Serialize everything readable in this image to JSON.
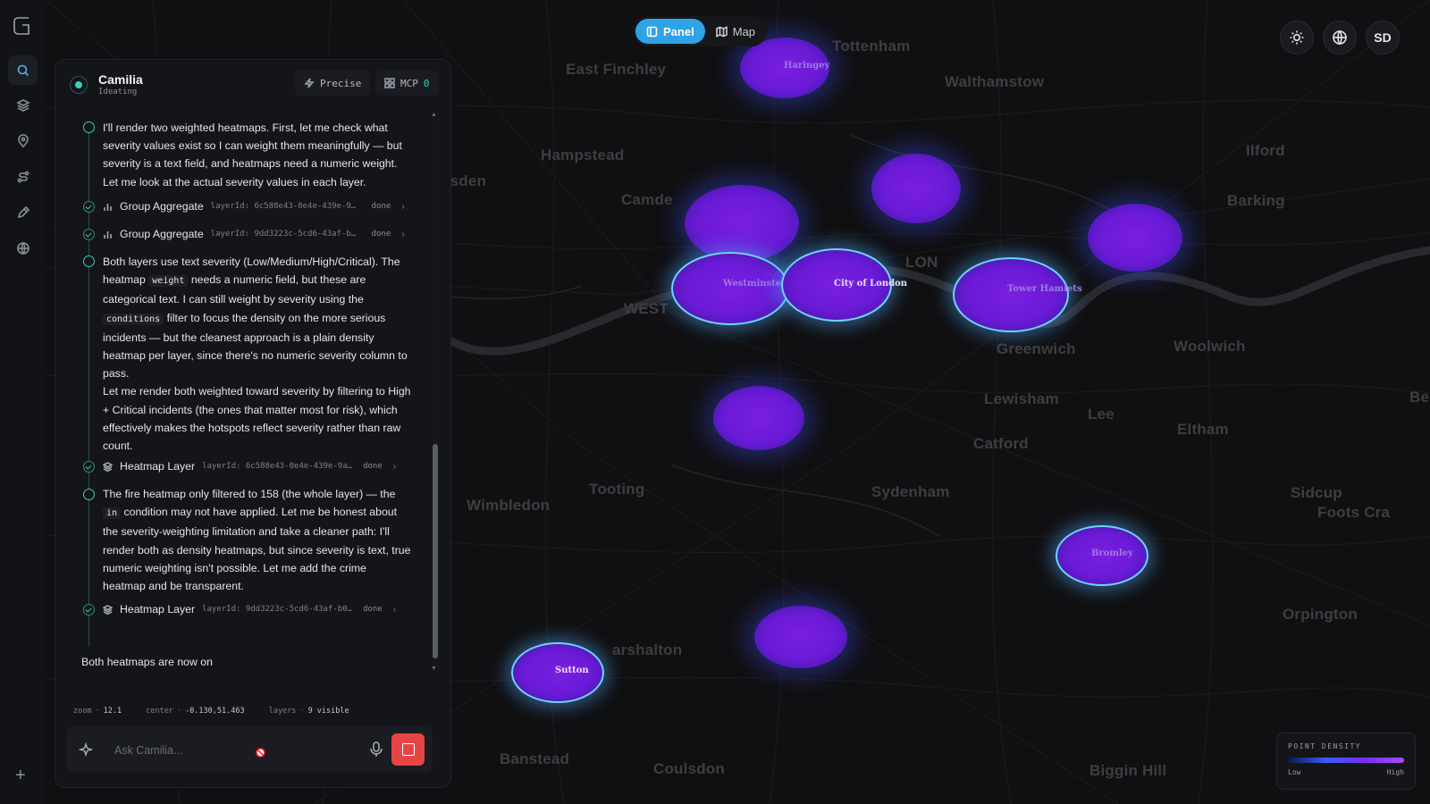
{
  "toggle": {
    "panel_label": "Panel",
    "map_label": "Map"
  },
  "user": {
    "initials": "SD"
  },
  "legend": {
    "title": "POINT DENSITY",
    "low": "Low",
    "high": "High"
  },
  "map": {
    "places": [
      "Tottenham",
      "East Finchley",
      "Walthamstow",
      "Hampstead",
      "Ilford",
      "esden",
      "Camde",
      "Barking",
      "LON",
      "WEST",
      "Greenwich",
      "Woolwich",
      "Lewisham",
      "Lee",
      "Eltham",
      "Be",
      "Catford",
      "Tooting",
      "Sydenham",
      "Wimbledon",
      "Sidcup",
      "Foots Cra",
      "Orpington",
      "arshalton",
      "Banstead",
      "Coulsdon",
      "Biggin Hill"
    ],
    "blob_labels": [
      "Haringey",
      "Westminster",
      "City of London",
      "Tower Hamlets",
      "Bromley",
      "Sutton"
    ]
  },
  "agent": {
    "name": "Camilia",
    "status": "Ideating",
    "mode_label": "Precise",
    "mcp_label": "MCP",
    "mcp_count": "0"
  },
  "messages": {
    "m1": "I'll render two weighted heatmaps. First, let me check what severity values exist so I can weight them meaningfully — but severity is a text field, and heatmaps need a numeric weight. Let me look at the actual severity values in each layer.",
    "t1": {
      "name": "Group Aggregate",
      "id": "layerId: 6c588e43-0e4e-439e-9…",
      "state": "done"
    },
    "t2": {
      "name": "Group Aggregate",
      "id": "layerId: 9dd3223c-5cd6-43af-b…",
      "state": "done"
    },
    "m2a": "Both layers use text severity (Low/Medium/High/Critical). The heatmap",
    "m2_code1": "weight",
    "m2b": "needs a numeric field, but these are categorical text. I can still weight by severity using the",
    "m2_code2": "conditions",
    "m2c": "filter to focus the density on the more serious incidents — but the cleanest approach is a plain density heatmap per layer, since there's no numeric severity column to pass.",
    "m2d": "Let me render both weighted toward severity by filtering to High + Critical incidents (the ones that matter most for risk), which effectively makes the hotspots reflect severity rather than raw count.",
    "t3": {
      "name": "Heatmap Layer",
      "id": "layerId: 6c588e43-0e4e-439e-9a2…",
      "state": "done"
    },
    "m3a": "The fire heatmap only filtered to 158 (the whole layer) — the",
    "m3_code": "in",
    "m3b": "condition may not have applied. Let me be honest about the severity-weighting limitation and take a cleaner path: I'll render both as density heatmaps, but since severity is text, true numeric weighting isn't possible. Let me add the crime heatmap and be transparent.",
    "t4": {
      "name": "Heatmap Layer",
      "id": "layerId: 9dd3223c-5cd6-43af-b0b…",
      "state": "done"
    },
    "final": "Both heatmaps are now on"
  },
  "stats": {
    "zoom_label": "zoom",
    "zoom": "12.1",
    "center_label": "center",
    "center": "-0.130,51.463",
    "layers_label": "layers",
    "layers": "9 visible"
  },
  "composer": {
    "placeholder": "Ask Camilia..."
  }
}
